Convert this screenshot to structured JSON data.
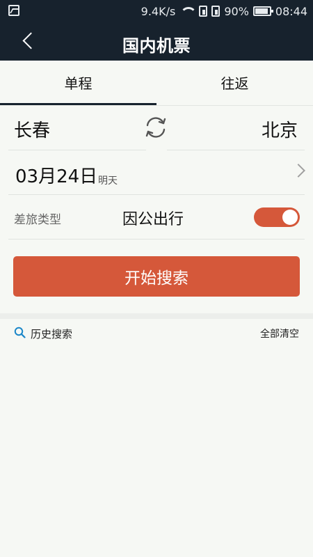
{
  "status_bar": {
    "speed": "9.4K/s",
    "battery_percent": "90%",
    "time": "08:44",
    "icons": [
      "image-icon",
      "wifi-icon",
      "sim-icon",
      "sim-icon",
      "battery-icon"
    ]
  },
  "nav": {
    "title": "国内机票",
    "back_icon": "chevron-left-icon"
  },
  "tabs": [
    {
      "label": "单程",
      "selected": true
    },
    {
      "label": "往返",
      "selected": false
    }
  ],
  "route": {
    "from": "长春",
    "to": "北京",
    "swap_icon": "swap-refresh-icon"
  },
  "date": {
    "value": "03月24日",
    "sub": "明天",
    "chevron_icon": "chevron-right-icon"
  },
  "trip_type": {
    "label": "差旅类型",
    "value": "因公出行",
    "toggle_on": true
  },
  "search_button": {
    "label": "开始搜索"
  },
  "history": {
    "label": "历史搜索",
    "clear_label": "全部清空",
    "icon": "search-icon"
  },
  "colors": {
    "header_bg": "#17222d",
    "accent": "#d5583a",
    "page_bg": "#f6f8f4"
  }
}
